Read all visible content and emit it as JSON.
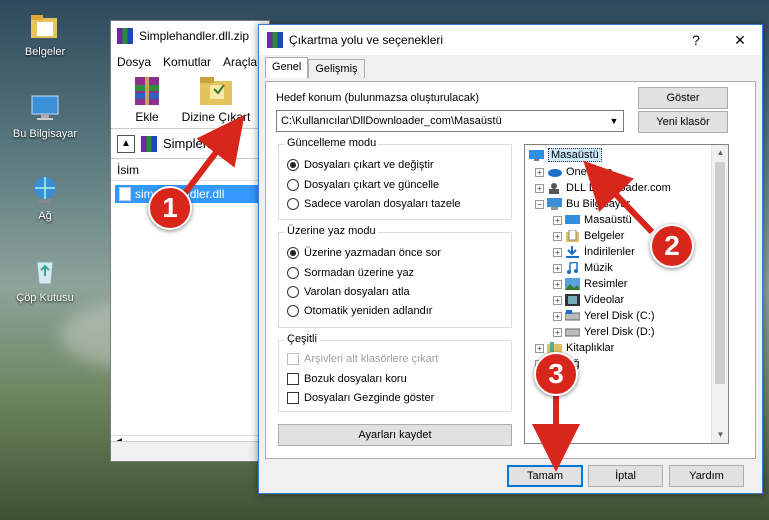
{
  "desktop": {
    "icons": [
      {
        "label": "Belgeler"
      },
      {
        "label": "Bu Bilgisayar"
      },
      {
        "label": "Ağ"
      },
      {
        "label": "Çöp Kutusu"
      }
    ]
  },
  "bg_window": {
    "title": "Simplehandler.dll.zip",
    "menu": [
      "Dosya",
      "Komutlar",
      "Araçla"
    ],
    "toolbar": {
      "extract": "Ekle",
      "extract_to": "Dizine Çıkart"
    },
    "path_text": "Simplehand",
    "column_name": "İsim",
    "file": "simplehandler.dll"
  },
  "dialog": {
    "title": "Çıkartma yolu ve seçenekleri",
    "help": "?",
    "close": "✕",
    "tabs": [
      "Genel",
      "Gelişmiş"
    ],
    "dest_label": "Hedef konum (bulunmazsa oluşturulacak)",
    "dest_value": "C:\\Kullanıcılar\\DllDownloader_com\\Masaüstü",
    "show_button": "Göster",
    "new_folder_button": "Yeni klasör",
    "update_mode": {
      "title": "Güncelleme modu",
      "options": [
        "Dosyaları çıkart ve değiştir",
        "Dosyaları çıkart ve güncelle",
        "Sadece varolan dosyaları tazele"
      ],
      "selected": 0
    },
    "overwrite_mode": {
      "title": "Üzerine yaz modu",
      "options": [
        "Üzerine yazmadan önce sor",
        "Sormadan üzerine yaz",
        "Varolan dosyaları atla",
        "Otomatik yeniden adlandır"
      ],
      "selected": 0
    },
    "misc": {
      "title": "Çeşitli",
      "options": [
        "Arşivleri alt klasörlere çıkart",
        "Bozuk dosyaları koru",
        "Dosyaları Gezginde göster"
      ]
    },
    "save_settings": "Ayarları kaydet",
    "tree": {
      "root": "Masaüstü",
      "onedrive": "OneDrive",
      "dlldownloader": "DLL Downloader.com",
      "thispc": "Bu Bilgisayar",
      "children": [
        "Masaüstü",
        "Belgeler",
        "İndirilenler",
        "Müzik",
        "Resimler",
        "Videolar",
        "Yerel Disk (C:)",
        "Yerel Disk (D:)"
      ],
      "libraries": "Kitaplıklar",
      "network": "Ağ"
    },
    "ok_button": "Tamam",
    "cancel_button": "İptal",
    "help_button": "Yardım"
  },
  "callouts": [
    "1",
    "2",
    "3"
  ],
  "colors": {
    "callout": "#d9261c",
    "selection": "#3399ff",
    "tree_selection": "#cce8ff"
  }
}
